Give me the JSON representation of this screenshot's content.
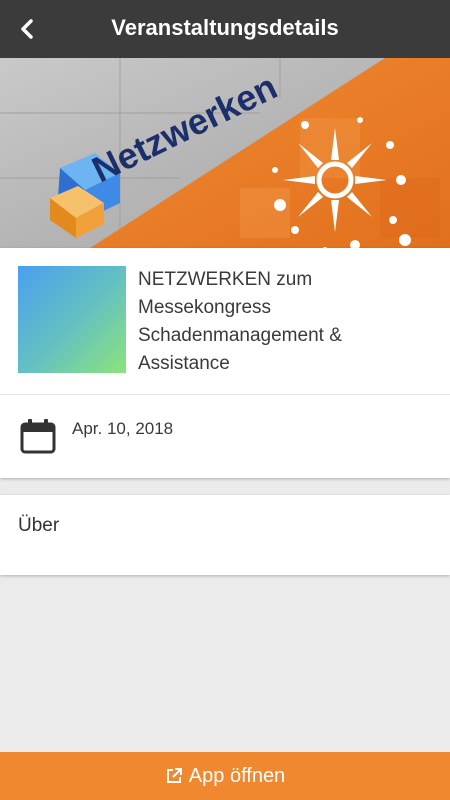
{
  "header": {
    "title": "Veranstaltungsdetails",
    "back_icon": "chevron-left-icon"
  },
  "banner": {
    "logo_text": "Netzwerken",
    "accent_color": "#f0882f"
  },
  "event": {
    "title": "NETZWERKEN zum Messekongress Schadenmanagement & Assistance",
    "date": "Apr. 10, 2018",
    "date_icon": "calendar-icon"
  },
  "about": {
    "label": "Über"
  },
  "footer": {
    "open_app_label": "App öffnen",
    "icon": "external-link-icon"
  }
}
